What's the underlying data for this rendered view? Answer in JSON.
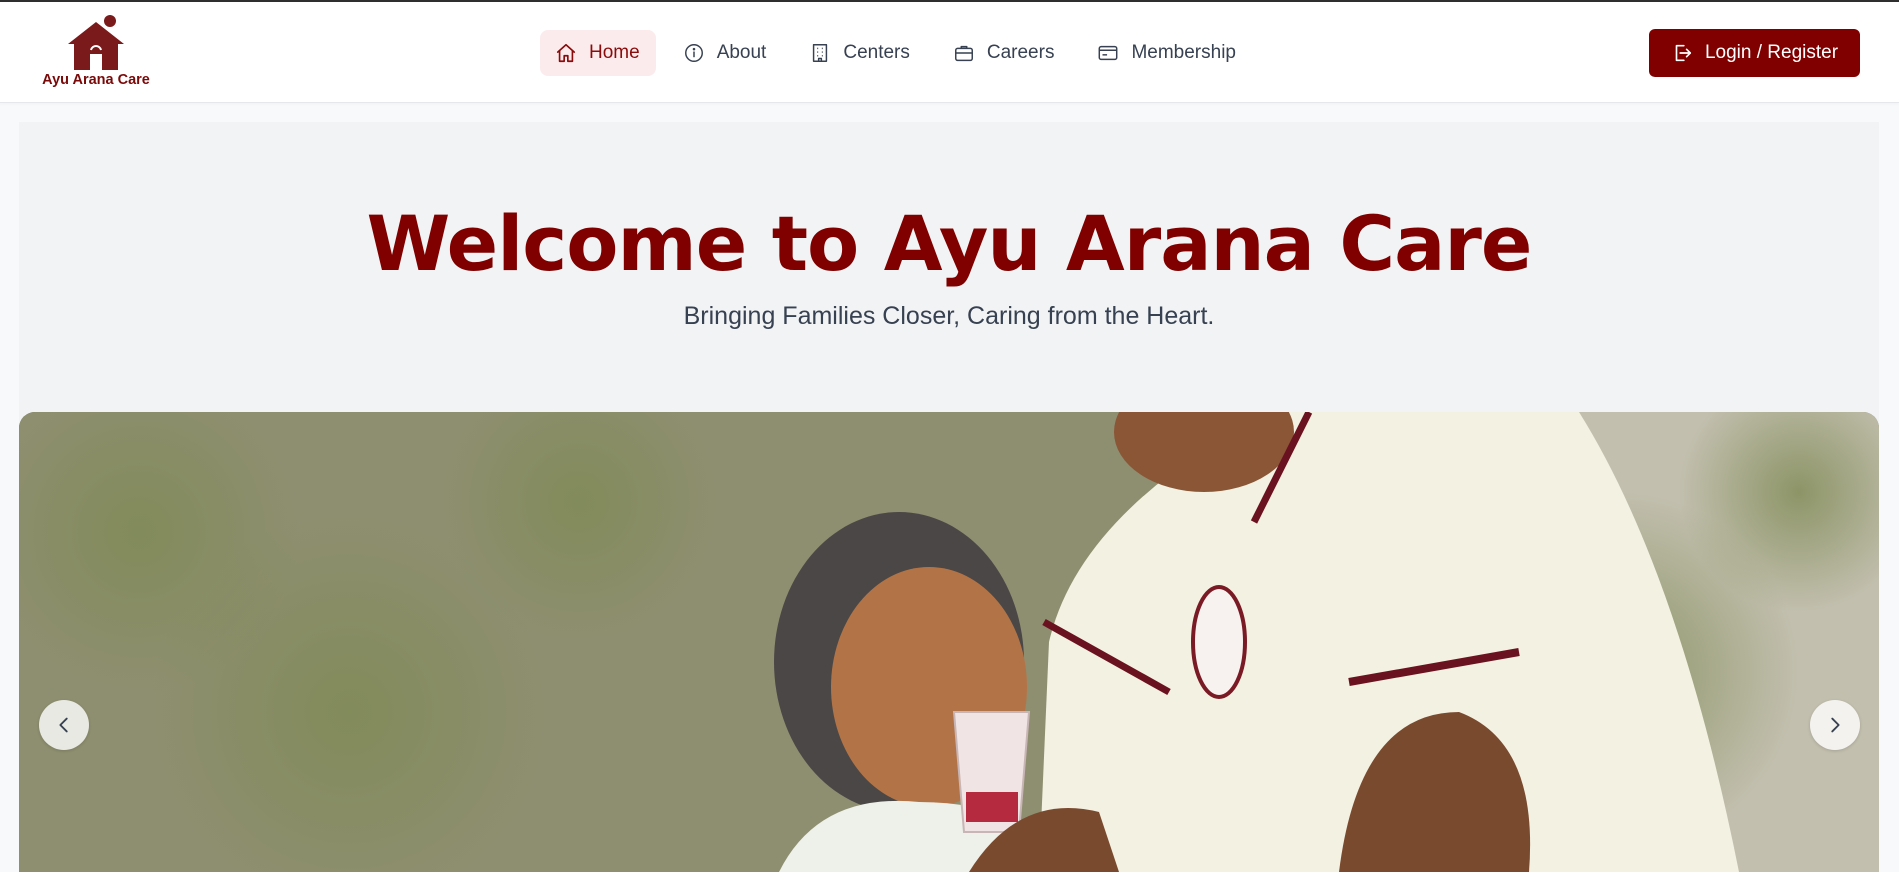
{
  "brand": {
    "name": "Ayu Arana Care",
    "color": "#800000"
  },
  "nav": {
    "items": [
      {
        "label": "Home",
        "icon": "home-icon",
        "active": true
      },
      {
        "label": "About",
        "icon": "info-icon",
        "active": false
      },
      {
        "label": "Centers",
        "icon": "building-icon",
        "active": false
      },
      {
        "label": "Careers",
        "icon": "briefcase-icon",
        "active": false
      },
      {
        "label": "Membership",
        "icon": "credit-card-icon",
        "active": false
      }
    ],
    "login_label": "Login / Register",
    "login_icon": "login-icon"
  },
  "hero": {
    "title": "Welcome to Ayu Arana Care",
    "subtitle": "Bringing Families Closer, Caring from the Heart."
  },
  "carousel": {
    "image": "elderly-woman-and-nurse-photo",
    "prev_icon": "chevron-left-icon",
    "next_icon": "chevron-right-icon"
  }
}
